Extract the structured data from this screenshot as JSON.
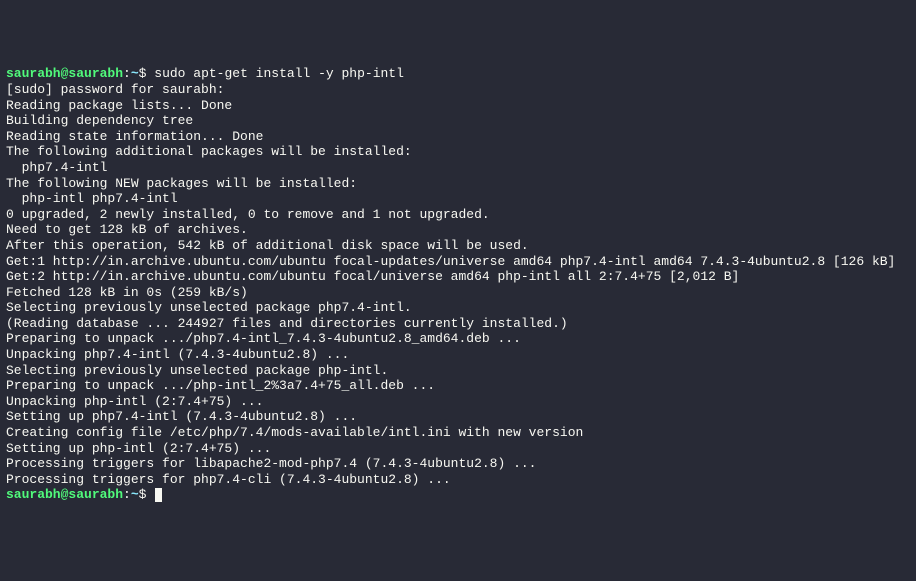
{
  "prompt1": {
    "userhost": "saurabh@saurabh",
    "colon": ":",
    "tilde": "~",
    "dollar": "$ ",
    "command": "sudo apt-get install -y php-intl"
  },
  "lines": [
    "[sudo] password for saurabh:",
    "Reading package lists... Done",
    "Building dependency tree",
    "Reading state information... Done",
    "The following additional packages will be installed:",
    "  php7.4-intl",
    "The following NEW packages will be installed:",
    "  php-intl php7.4-intl",
    "0 upgraded, 2 newly installed, 0 to remove and 1 not upgraded.",
    "Need to get 128 kB of archives.",
    "After this operation, 542 kB of additional disk space will be used.",
    "Get:1 http://in.archive.ubuntu.com/ubuntu focal-updates/universe amd64 php7.4-intl amd64 7.4.3-4ubuntu2.8 [126 kB]",
    "Get:2 http://in.archive.ubuntu.com/ubuntu focal/universe amd64 php-intl all 2:7.4+75 [2,012 B]",
    "Fetched 128 kB in 0s (259 kB/s)",
    "Selecting previously unselected package php7.4-intl.",
    "(Reading database ... 244927 files and directories currently installed.)",
    "Preparing to unpack .../php7.4-intl_7.4.3-4ubuntu2.8_amd64.deb ...",
    "Unpacking php7.4-intl (7.4.3-4ubuntu2.8) ...",
    "Selecting previously unselected package php-intl.",
    "Preparing to unpack .../php-intl_2%3a7.4+75_all.deb ...",
    "Unpacking php-intl (2:7.4+75) ...",
    "Setting up php7.4-intl (7.4.3-4ubuntu2.8) ...",
    "",
    "Creating config file /etc/php/7.4/mods-available/intl.ini with new version",
    "Setting up php-intl (2:7.4+75) ...",
    "Processing triggers for libapache2-mod-php7.4 (7.4.3-4ubuntu2.8) ...",
    "Processing triggers for php7.4-cli (7.4.3-4ubuntu2.8) ..."
  ],
  "prompt2": {
    "userhost": "saurabh@saurabh",
    "colon": ":",
    "tilde": "~",
    "dollar": "$ "
  }
}
